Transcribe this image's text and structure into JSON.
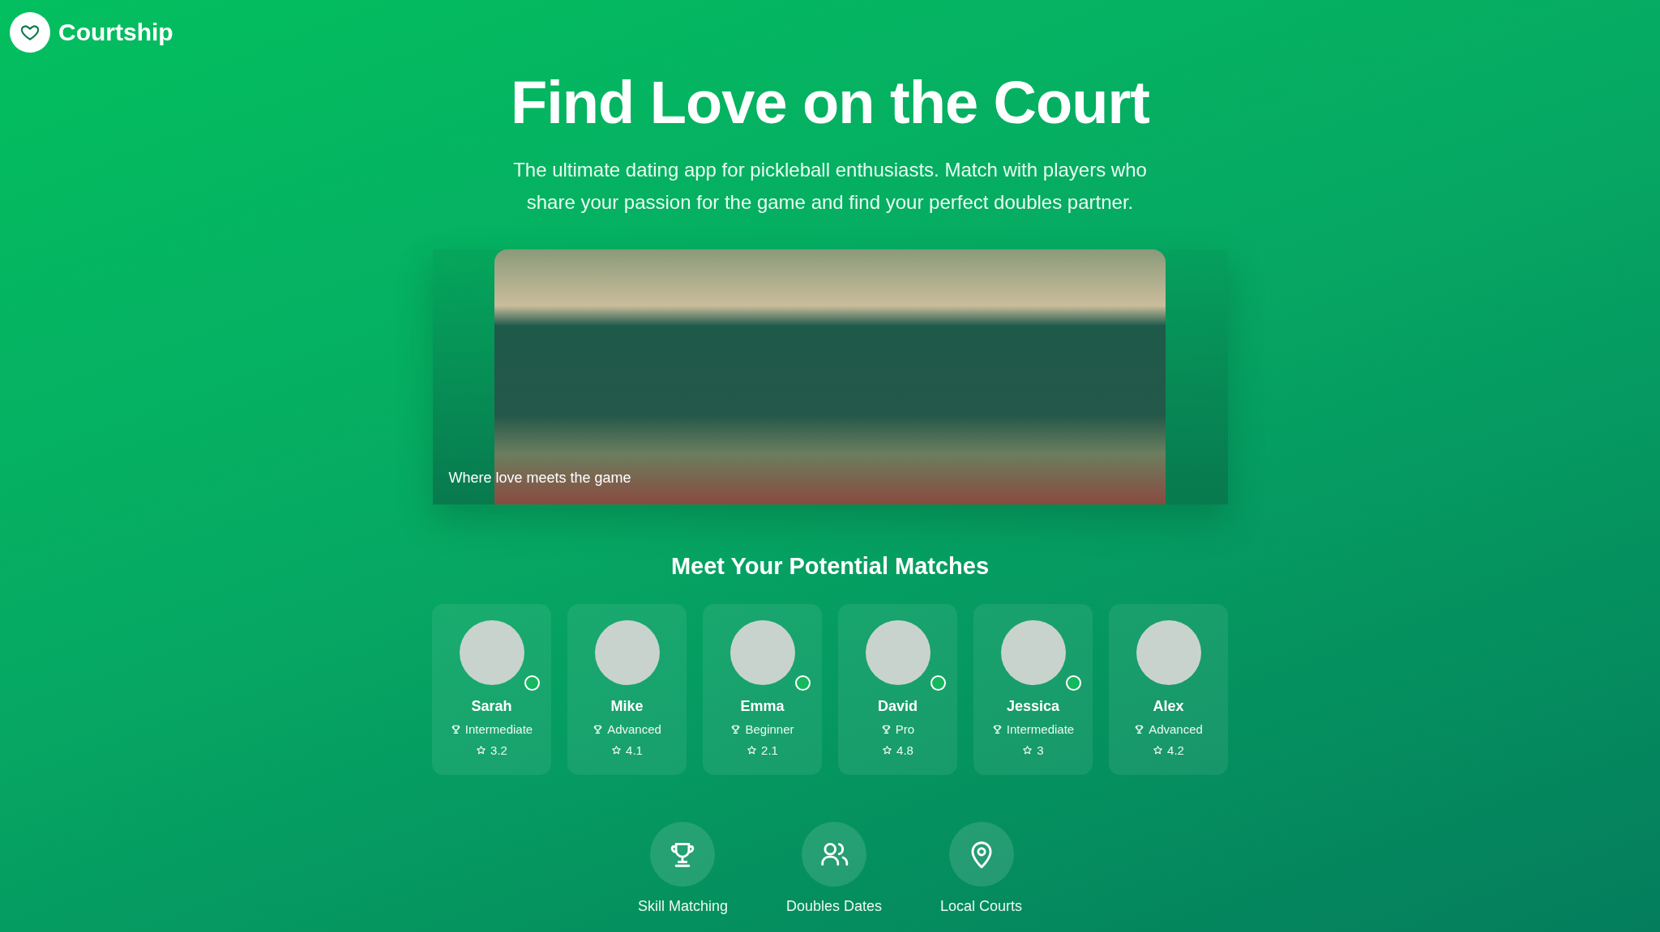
{
  "brand": {
    "name": "Courtship"
  },
  "hero": {
    "title": "Find Love on the Court",
    "subtitle": "The ultimate dating app for pickleball enthusiasts. Match with players who share your passion for the game and find your perfect doubles partner.",
    "caption": "Where love meets the game"
  },
  "matches": {
    "title": "Meet Your Potential Matches",
    "profiles": [
      {
        "name": "Sarah",
        "level": "Intermediate",
        "rating": "3.2",
        "online": true
      },
      {
        "name": "Mike",
        "level": "Advanced",
        "rating": "4.1",
        "online": false
      },
      {
        "name": "Emma",
        "level": "Beginner",
        "rating": "2.1",
        "online": true
      },
      {
        "name": "David",
        "level": "Pro",
        "rating": "4.8",
        "online": true
      },
      {
        "name": "Jessica",
        "level": "Intermediate",
        "rating": "3",
        "online": true
      },
      {
        "name": "Alex",
        "level": "Advanced",
        "rating": "4.2",
        "online": false
      }
    ]
  },
  "features": [
    {
      "kind": "trophy",
      "label": "Skill Matching"
    },
    {
      "kind": "people",
      "label": "Doubles Dates"
    },
    {
      "kind": "pin",
      "label": "Local Courts"
    }
  ]
}
